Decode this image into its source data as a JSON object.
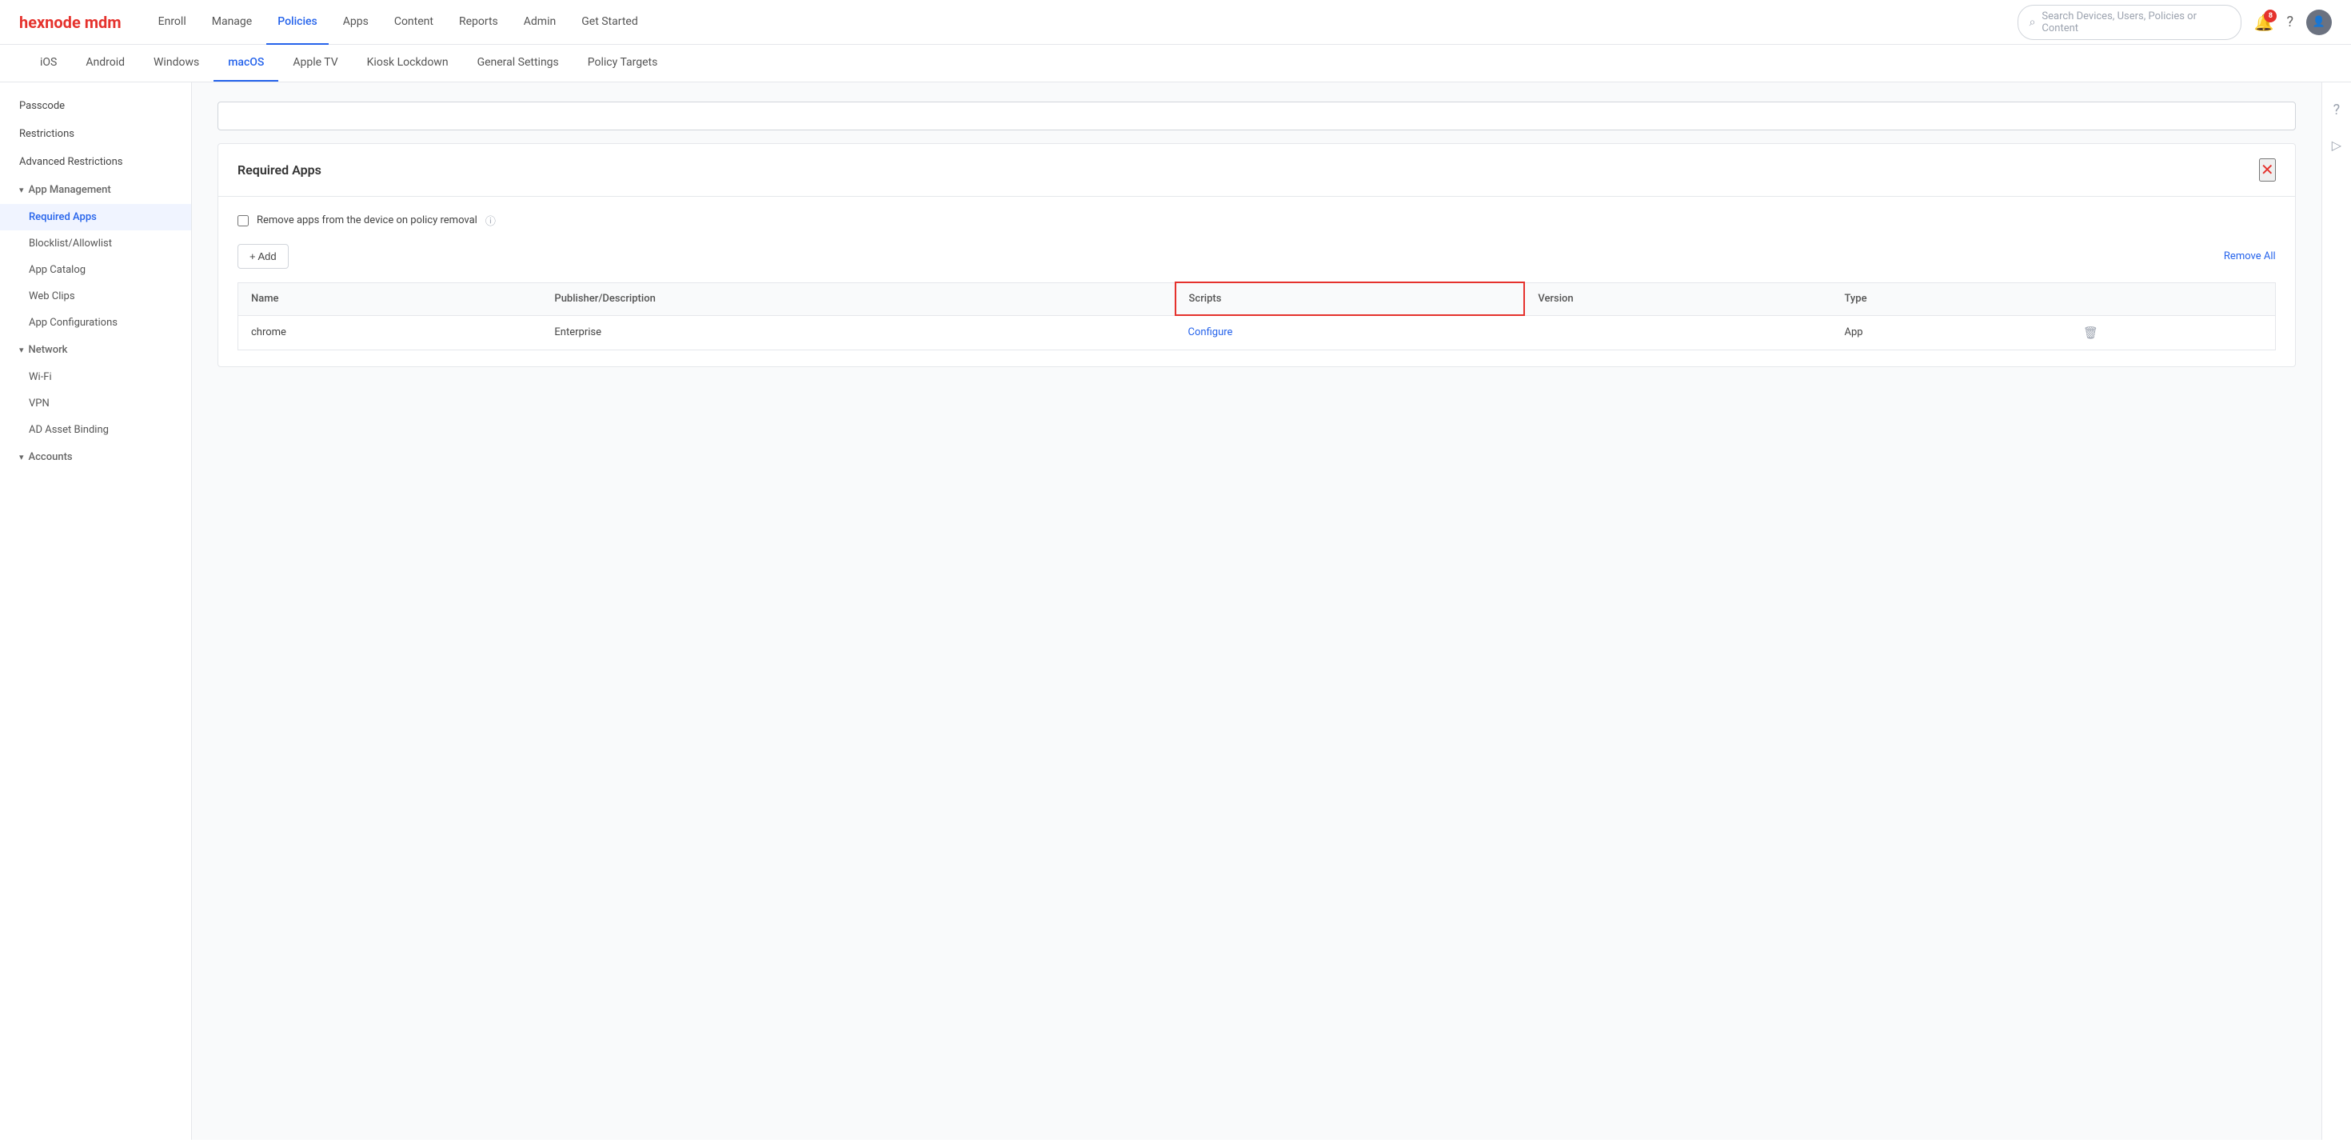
{
  "brand": {
    "logo_text": "hexnode",
    "logo_suffix": " mdm"
  },
  "nav": {
    "items": [
      {
        "label": "Enroll",
        "active": false
      },
      {
        "label": "Manage",
        "active": false
      },
      {
        "label": "Policies",
        "active": true
      },
      {
        "label": "Apps",
        "active": false
      },
      {
        "label": "Content",
        "active": false
      },
      {
        "label": "Reports",
        "active": false
      },
      {
        "label": "Admin",
        "active": false
      },
      {
        "label": "Get Started",
        "active": false
      }
    ],
    "search_placeholder": "Search Devices, Users, Policies or Content",
    "notification_count": "8"
  },
  "sub_tabs": [
    {
      "label": "iOS",
      "active": false
    },
    {
      "label": "Android",
      "active": false
    },
    {
      "label": "Windows",
      "active": false
    },
    {
      "label": "macOS",
      "active": true
    },
    {
      "label": "Apple TV",
      "active": false
    },
    {
      "label": "Kiosk Lockdown",
      "active": false
    },
    {
      "label": "General Settings",
      "active": false
    },
    {
      "label": "Policy Targets",
      "active": false
    }
  ],
  "sidebar": {
    "items": [
      {
        "label": "Passcode",
        "type": "item",
        "active": false
      },
      {
        "label": "Restrictions",
        "type": "item",
        "active": false
      },
      {
        "label": "Advanced Restrictions",
        "type": "item",
        "active": false
      },
      {
        "label": "App Management",
        "type": "section",
        "expanded": true
      },
      {
        "label": "Required Apps",
        "type": "sub-item",
        "active": true
      },
      {
        "label": "Blocklist/Allowlist",
        "type": "sub-item",
        "active": false
      },
      {
        "label": "App Catalog",
        "type": "sub-item",
        "active": false
      },
      {
        "label": "Web Clips",
        "type": "sub-item",
        "active": false
      },
      {
        "label": "App Configurations",
        "type": "sub-item",
        "active": false
      },
      {
        "label": "Network",
        "type": "section",
        "expanded": true
      },
      {
        "label": "Wi-Fi",
        "type": "sub-item",
        "active": false
      },
      {
        "label": "VPN",
        "type": "sub-item",
        "active": false
      },
      {
        "label": "AD Asset Binding",
        "type": "sub-item",
        "active": false
      },
      {
        "label": "Accounts",
        "type": "section",
        "expanded": false
      }
    ]
  },
  "panel": {
    "title": "Required Apps",
    "checkbox_label": "Remove apps from the device on policy removal",
    "add_btn": "+ Add",
    "remove_all": "Remove All",
    "table": {
      "columns": [
        "Name",
        "Publisher/Description",
        "Scripts",
        "Version",
        "Type"
      ],
      "rows": [
        {
          "name": "chrome",
          "publisher": "Enterprise",
          "scripts": "Configure",
          "version": "",
          "type": "App"
        }
      ]
    }
  }
}
